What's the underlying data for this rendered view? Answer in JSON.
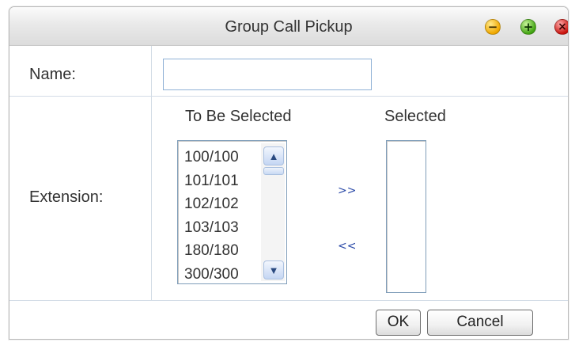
{
  "dialog": {
    "title": "Group Call Pickup",
    "window_buttons": [
      {
        "name": "minimize-icon",
        "glyph": "−",
        "color": "#f0a800"
      },
      {
        "name": "maximize-icon",
        "glyph": "+",
        "color": "#43a513"
      },
      {
        "name": "close-icon",
        "glyph": "×",
        "color": "#c9140e"
      }
    ]
  },
  "form": {
    "name_label": "Name:",
    "name_value": "",
    "extension_label": "Extension:",
    "to_be_selected_header": "To Be Selected",
    "selected_header": "Selected",
    "available_extensions": [
      "100/100",
      "101/101",
      "102/102",
      "103/103",
      "180/180",
      "300/300"
    ],
    "selected_extensions": [],
    "add_label": ">>",
    "remove_label": "<<"
  },
  "buttons": {
    "ok_label": "OK",
    "cancel_label": "Cancel"
  }
}
